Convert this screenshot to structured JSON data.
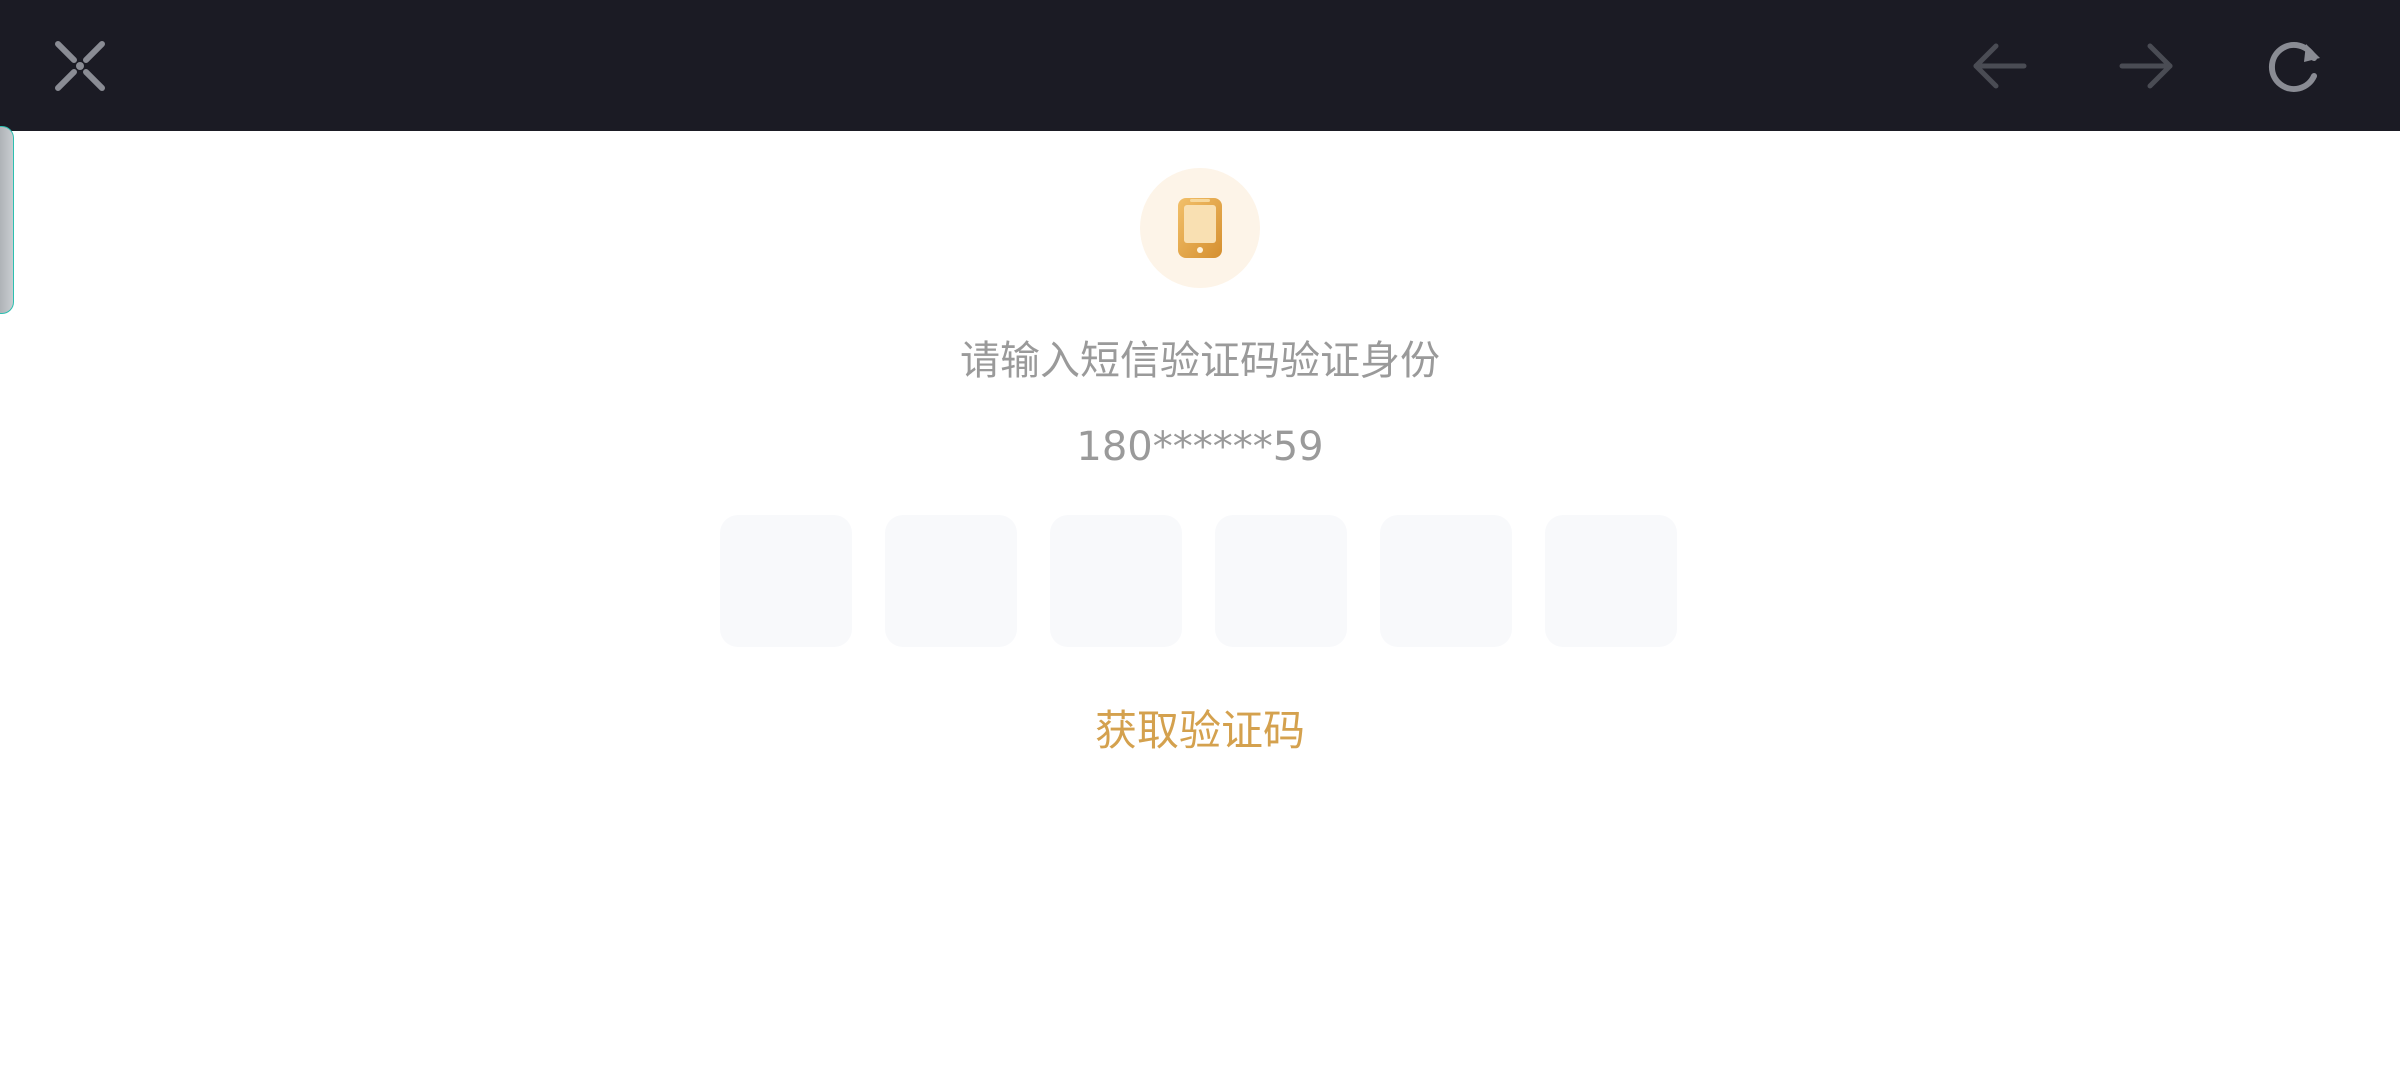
{
  "toolbar": {
    "close_icon": "close-x-icon",
    "back_icon": "arrow-left-icon",
    "forward_icon": "arrow-right-icon",
    "reload_icon": "reload-icon"
  },
  "verify": {
    "badge_icon": "phone-icon",
    "prompt": "请输入短信验证码验证身份",
    "phone": "180******59",
    "code_boxes": [
      "",
      "",
      "",
      "",
      "",
      ""
    ],
    "get_code_label": "获取验证码"
  },
  "colors": {
    "topbar_bg": "#1b1b24",
    "accent": "#d4a14e",
    "badge_bg": "#fdf4e8",
    "box_bg": "#f8f9fb",
    "muted_text": "#9a9a9a"
  }
}
